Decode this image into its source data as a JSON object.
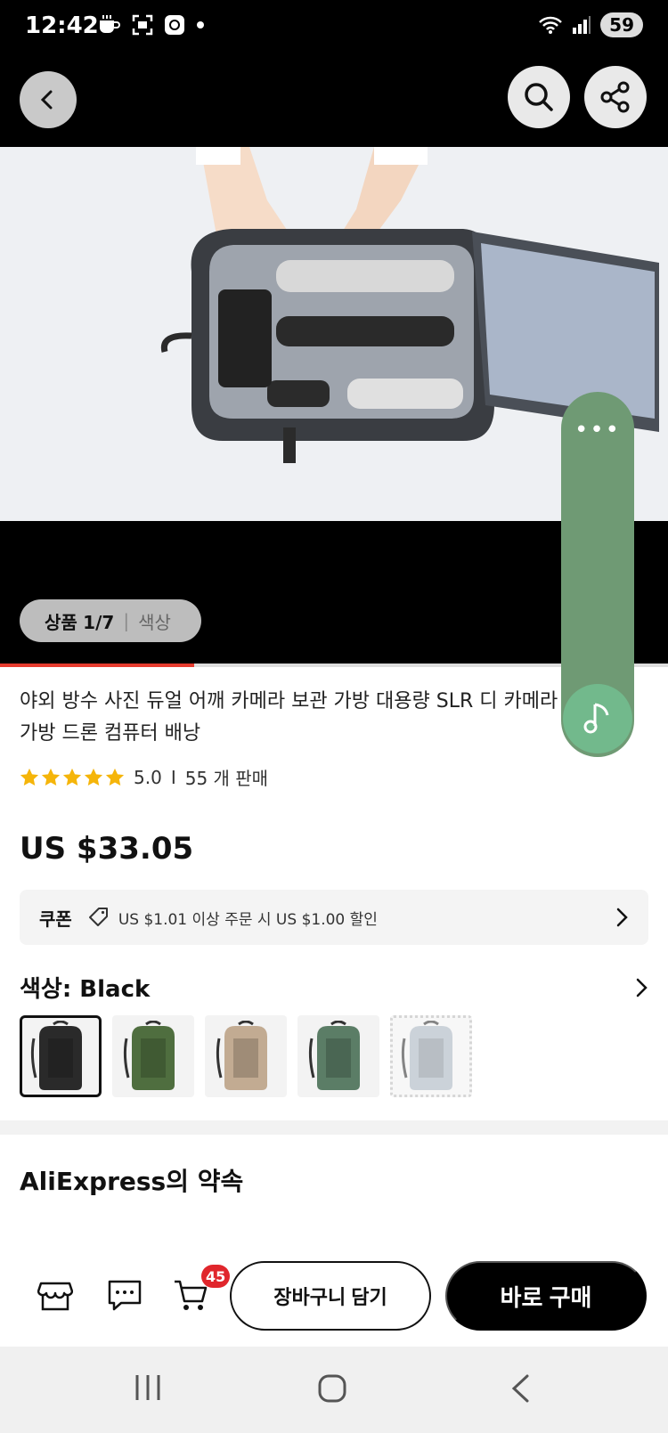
{
  "status_bar": {
    "time": "12:42",
    "battery": "59"
  },
  "gallery": {
    "product_tab": "상품",
    "counter": "1/7",
    "color_tab": "색상",
    "progress": 0.29
  },
  "product": {
    "title": "야외 방수 사진 듀얼 어깨 카메라 보관 가방 대용량 SLR 디 카메라 가방 드론 컴퓨터 배낭",
    "rating": "5.0",
    "sold": "55 개 판매",
    "price": "US $33.05"
  },
  "coupon": {
    "label": "쿠폰",
    "text": "US $1.01 이상 주문 시 US $1.00 할인"
  },
  "color": {
    "label": "색상: Black",
    "swatches": [
      {
        "color": "#2a2a2a",
        "state": "selected"
      },
      {
        "color": "#4f6e3f",
        "state": "available"
      },
      {
        "color": "#c2ab92",
        "state": "available"
      },
      {
        "color": "#5b7d66",
        "state": "available"
      },
      {
        "color": "#a9b5c0",
        "state": "sold-out"
      }
    ]
  },
  "promise": {
    "title": "AliExpress의 약속"
  },
  "bottom_bar": {
    "cart_count": "45",
    "add_to_cart": "장바구니 담기",
    "buy_now": "바로 구매"
  },
  "colors": {
    "accent": "#e63b2e",
    "floating_panel": "#6f9a74",
    "music_button": "#72b98c",
    "badge": "#e0262c"
  }
}
